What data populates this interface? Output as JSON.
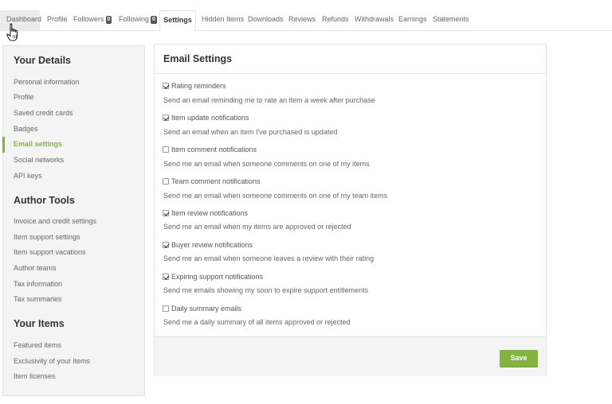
{
  "tabs": [
    {
      "label": "Dashboard"
    },
    {
      "label": "Profile"
    },
    {
      "label": "Followers",
      "badge": "0"
    },
    {
      "label": "Following",
      "badge": "0"
    },
    {
      "label": "Settings"
    },
    {
      "label": "Hidden Items"
    },
    {
      "label": "Downloads"
    },
    {
      "label": "Reviews"
    },
    {
      "label": "Refunds"
    },
    {
      "label": "Withdrawals"
    },
    {
      "label": "Earnings"
    },
    {
      "label": "Statements"
    }
  ],
  "sidebar": {
    "your_details": {
      "title": "Your Details",
      "items": [
        "Personal information",
        "Profile",
        "Saved credit cards",
        "Badges",
        "Email settings",
        "Social networks",
        "API keys"
      ]
    },
    "author_tools": {
      "title": "Author Tools",
      "items": [
        "Invoice and credit settings",
        "Item support settings",
        "Item support vacations",
        "Author teams",
        "Tax information",
        "Tax summaries"
      ]
    },
    "your_items": {
      "title": "Your Items",
      "items": [
        "Featured items",
        "Exclusivity of your items",
        "Item licenses"
      ]
    }
  },
  "email_settings": {
    "title": "Email Settings",
    "options": [
      {
        "label": "Rating reminders",
        "checked": true,
        "description": "Send an email reminding me to rate an item a week after purchase"
      },
      {
        "label": "Item update notifications",
        "checked": true,
        "description": "Send an email when an item I've purchased is updated"
      },
      {
        "label": "Item comment notifications",
        "checked": false,
        "description": "Send me an email when someone comments on one of my items"
      },
      {
        "label": "Team comment notifications",
        "checked": false,
        "description": "Send me an email when someone comments on one of my team items"
      },
      {
        "label": "Item review notifications",
        "checked": true,
        "description": "Send me an email when my items are approved or rejected"
      },
      {
        "label": "Buyer review notifications",
        "checked": true,
        "description": "Send me an email when someone leaves a review with their rating"
      },
      {
        "label": "Expiring support notifications",
        "checked": true,
        "description": "Send me emails showing my soon to expire support entitlements"
      },
      {
        "label": "Daily summary emails",
        "checked": false,
        "description": "Send me a daily summary of all items approved or rejected"
      }
    ],
    "save_label": "Save"
  },
  "colors": {
    "accent": "#82b440"
  }
}
